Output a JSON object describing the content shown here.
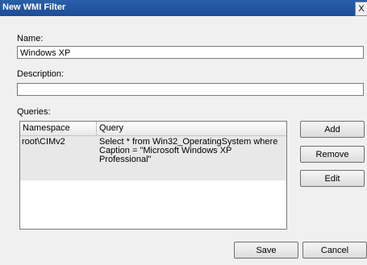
{
  "window": {
    "title": "New WMI Filter",
    "close_label": "X"
  },
  "name": {
    "label": "Name:",
    "value": "Windows XP"
  },
  "description": {
    "label": "Description:",
    "value": ""
  },
  "queries": {
    "label": "Queries:",
    "columns": [
      "Namespace",
      "Query"
    ],
    "rows": [
      {
        "namespace": "root\\CIMv2",
        "query": "Select * from Win32_OperatingSystem where Caption = \"Microsoft Windows XP Professional\""
      }
    ]
  },
  "buttons": {
    "add": "Add",
    "remove": "Remove",
    "edit": "Edit",
    "save": "Save",
    "cancel": "Cancel"
  }
}
